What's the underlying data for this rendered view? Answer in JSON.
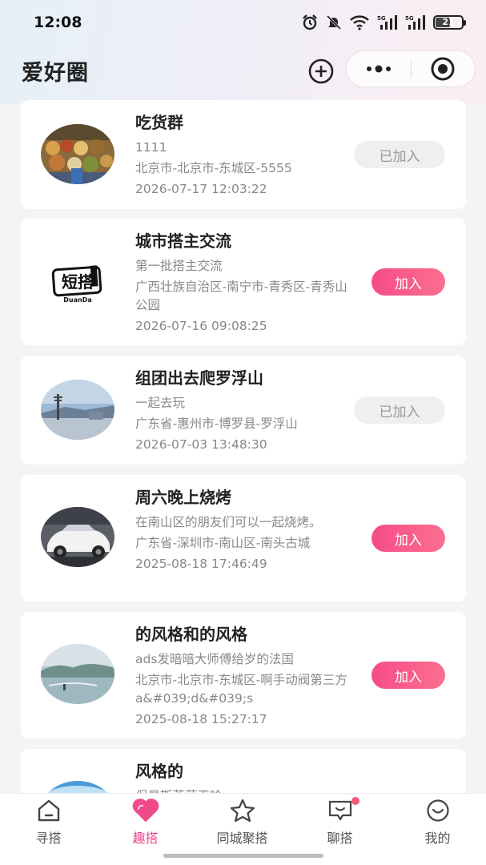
{
  "status_bar": {
    "time": "12:08",
    "battery": "21",
    "network_1": "5G",
    "network_2": "5G"
  },
  "header": {
    "title": "爱好圈"
  },
  "groups": [
    {
      "name": "吃货群",
      "desc": "1111",
      "addr": "北京市-北京市-东城区-5555",
      "time": "2026-07-17 12:03:22",
      "button": "已加入",
      "joined": true
    },
    {
      "name": "城市搭主交流",
      "desc": "第一批搭主交流",
      "addr": "广西壮族自治区-南宁市-青秀区-青秀山公园",
      "time": "2026-07-16 09:08:25",
      "button": "加入",
      "joined": false,
      "logo_main": "短搭",
      "logo_sub": "DuanDa"
    },
    {
      "name": "组团出去爬罗浮山",
      "desc": "一起去玩",
      "addr": "广东省-惠州市-博罗县-罗浮山",
      "time": "2026-07-03 13:48:30",
      "button": "已加入",
      "joined": true
    },
    {
      "name": "周六晚上烧烤",
      "desc": "在南山区的朋友们可以一起烧烤。",
      "addr": "广东省-深圳市-南山区-南头古城",
      "time": "2025-08-18 17:46:49",
      "button": "加入",
      "joined": false
    },
    {
      "name": "的风格和的风格",
      "desc": "ads发暗暗大师傅给岁的法国",
      "addr": "北京市-北京市-东城区-啊手动阀第三方a&#039;d&#039;s",
      "time": "2025-08-18 15:27:17",
      "button": "加入",
      "joined": false
    },
    {
      "name": "风格的",
      "desc": "保是斯蒂芬干哈"
    }
  ],
  "tabbar": {
    "items": [
      {
        "label": "寻搭",
        "icon": "home-icon"
      },
      {
        "label": "趣搭",
        "icon": "heart-icon",
        "active": true
      },
      {
        "label": "同城聚搭",
        "icon": "star-icon"
      },
      {
        "label": "聊搭",
        "icon": "chat-icon",
        "badge": true
      },
      {
        "label": "我的",
        "icon": "smile-icon"
      }
    ]
  },
  "colors": {
    "accent": "#f0458a",
    "join_button": "#f64c88",
    "joined_button": "#efefef"
  }
}
